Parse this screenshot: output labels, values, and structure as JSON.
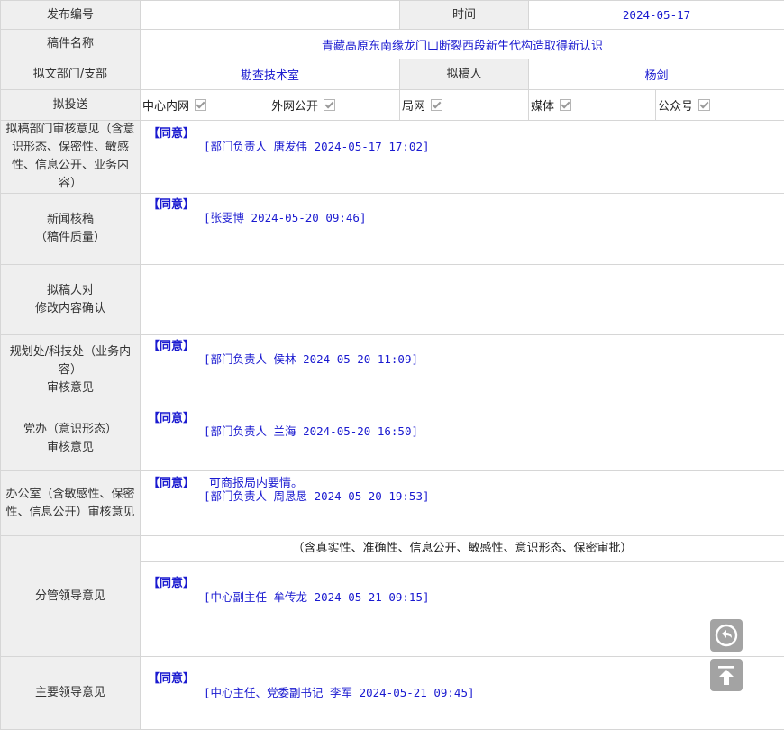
{
  "rows": {
    "pub_no_label": "发布编号",
    "pub_no_value": "",
    "time_label": "时间",
    "time_value": "2024-05-17",
    "title_label": "稿件名称",
    "title_value": "青藏高原东南缘龙门山断裂西段新生代构造取得新认识",
    "dept_label": "拟文部门/支部",
    "dept_value": "勘查技术室",
    "drafter_label": "拟稿人",
    "drafter_value": "杨剑",
    "target_label": "拟投送",
    "targets": [
      {
        "label": "中心内网",
        "checked": true
      },
      {
        "label": "外网公开",
        "checked": true
      },
      {
        "label": "局网",
        "checked": true
      },
      {
        "label": "媒体",
        "checked": true
      },
      {
        "label": "公众号",
        "checked": true
      }
    ]
  },
  "opinions": {
    "dept_review": {
      "label": "拟稿部门审核意见（含意识形态、保密性、敏感性、信息公开、业务内容）",
      "agree": "【同意】",
      "sign": "[部门负责人 唐发伟 2024-05-17 17:02]"
    },
    "news_review": {
      "label1": "新闻核稿",
      "label2": "（稿件质量）",
      "agree": "【同意】",
      "sign": "[张雯博 2024-05-20 09:46]"
    },
    "drafter_confirm": {
      "label1": "拟稿人对",
      "label2": "修改内容确认"
    },
    "planning": {
      "label1": "规划处/科技处（业务内容）",
      "label2": "审核意见",
      "agree": "【同意】",
      "sign": "[部门负责人 侯林 2024-05-20 11:09]"
    },
    "party": {
      "label1": "党办（意识形态）",
      "label2": "审核意见",
      "agree": "【同意】",
      "sign": "[部门负责人 兰海 2024-05-20 16:50]"
    },
    "office": {
      "label": "办公室（含敏感性、保密性、信息公开）审核意见",
      "agree": "【同意】",
      "comment": "可商报局内要情。",
      "sign": "[部门负责人 周恳恳 2024-05-20 19:53]"
    },
    "leader": {
      "label": "分管领导意见",
      "subheader": "（含真实性、准确性、信息公开、敏感性、意识形态、保密审批）",
      "agree": "【同意】",
      "sign": "[中心副主任 牟传龙 2024-05-21 09:15]"
    },
    "main_leader": {
      "label": "主要领导意见",
      "agree": "【同意】",
      "sign": "[中心主任、党委副书记 李军 2024-05-21 09:45]"
    }
  },
  "buttons": {
    "back_icon": "back-arrow-icon",
    "top_icon": "scroll-to-top-icon"
  }
}
